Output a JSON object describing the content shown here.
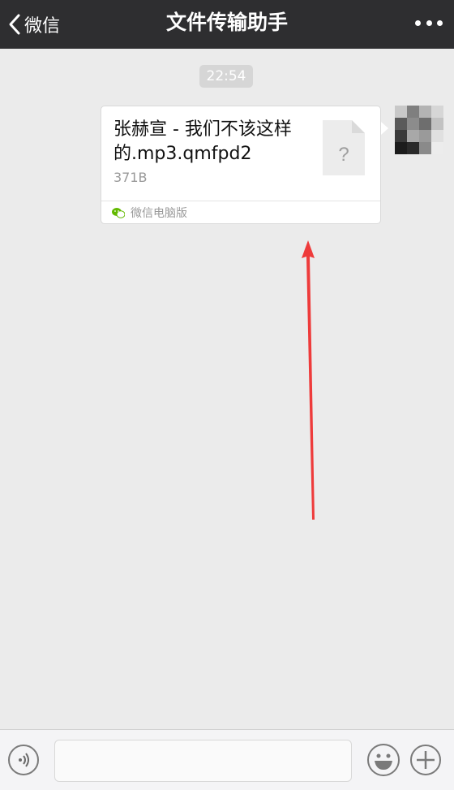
{
  "nav": {
    "back_label": "微信",
    "title": "文件传输助手"
  },
  "chat": {
    "timestamp": "22:54",
    "message": {
      "file_name": "张赫宣 - 我们不该这样的.mp3.qmfpd2",
      "file_size": "371B",
      "file_icon_glyph": "?",
      "source_label": "微信电脑版"
    }
  },
  "annotation": {
    "arrow_color": "#ee3b3b"
  },
  "colors": {
    "topbar": "#2e2e30",
    "background": "#ebebeb",
    "wechat_green": "#62b900"
  },
  "icons": {
    "back": "chevron-left-icon",
    "more": "more-dots-icon",
    "file": "unknown-file-icon",
    "voice": "voice-icon",
    "emoji": "emoji-icon",
    "plus": "plus-icon"
  }
}
